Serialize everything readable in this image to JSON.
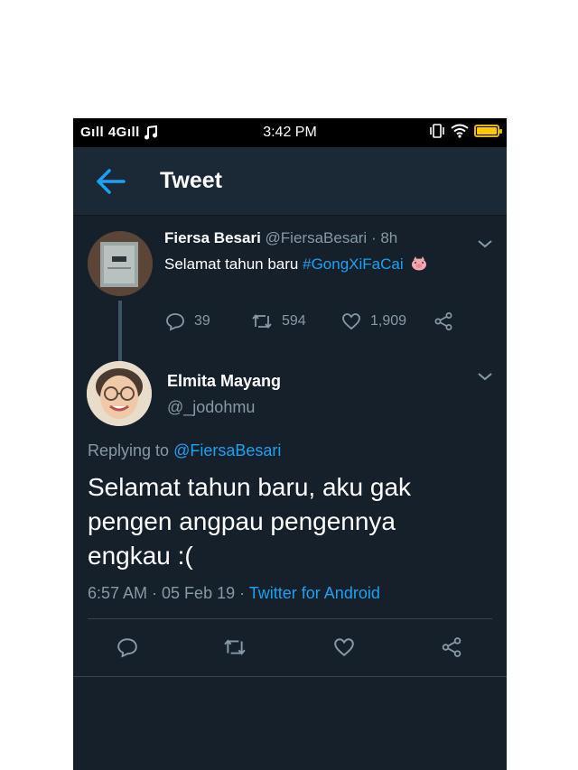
{
  "status_bar": {
    "network": "Gıll 4Gıll",
    "time": "3:42 PM",
    "battery_level": 0.9
  },
  "app_bar": {
    "title": "Tweet",
    "back_icon": "arrow-left-icon"
  },
  "parent_tweet": {
    "name": "Fiersa Besari",
    "handle": "@FiersaBesari",
    "age": "· 8h",
    "text": "Selamat tahun baru ",
    "hashtag": "#GongXiFaCai",
    "replies": "39",
    "retweets": "594",
    "likes": "1,909"
  },
  "reply_tweet": {
    "name": "Elmita Mayang",
    "handle": "@_jodohmu",
    "replying_prefix": "Replying to ",
    "replying_to": "@FiersaBesari",
    "text": "Selamat tahun baru, aku gak pengen angpau pengennya engkau :(",
    "time": "6:57 AM · 05 Feb 19 · ",
    "source": "Twitter for Android"
  },
  "colors": {
    "background": "#15202b",
    "accent": "#1da1f2",
    "secondary_text": "#8899a6"
  }
}
